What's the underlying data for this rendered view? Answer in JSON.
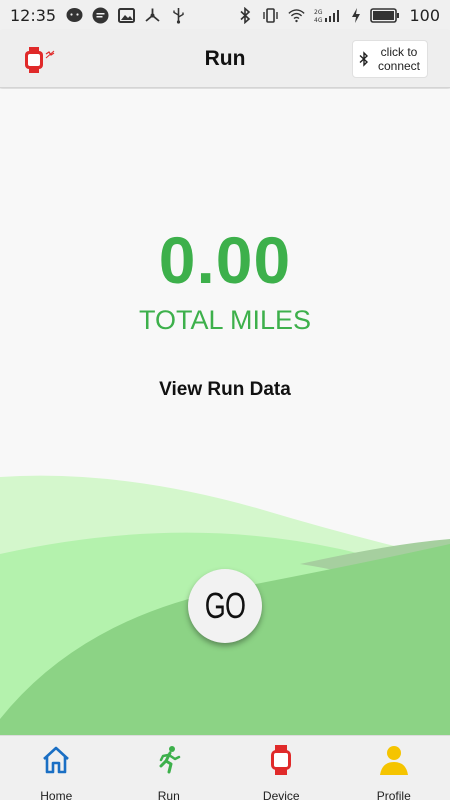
{
  "status_bar": {
    "time": "12:35",
    "battery_level": "100"
  },
  "header": {
    "title": "Run",
    "connect_button": {
      "line1": "click to",
      "line2": "connect"
    }
  },
  "run": {
    "total_miles": "0.00",
    "total_miles_label": "TOTAL MILES",
    "view_run_data_label": "View Run Data",
    "go_label": "GO"
  },
  "bottom_nav": {
    "items": [
      {
        "label": "Home",
        "icon": "home-icon"
      },
      {
        "label": "Run",
        "icon": "runner-icon"
      },
      {
        "label": "Device",
        "icon": "watch-icon"
      },
      {
        "label": "Profile",
        "icon": "person-icon"
      }
    ]
  },
  "colors": {
    "accent_green": "#3db04b",
    "home_blue": "#1a6fc4",
    "device_red": "#e02a2a",
    "profile_yellow": "#f5c400"
  }
}
